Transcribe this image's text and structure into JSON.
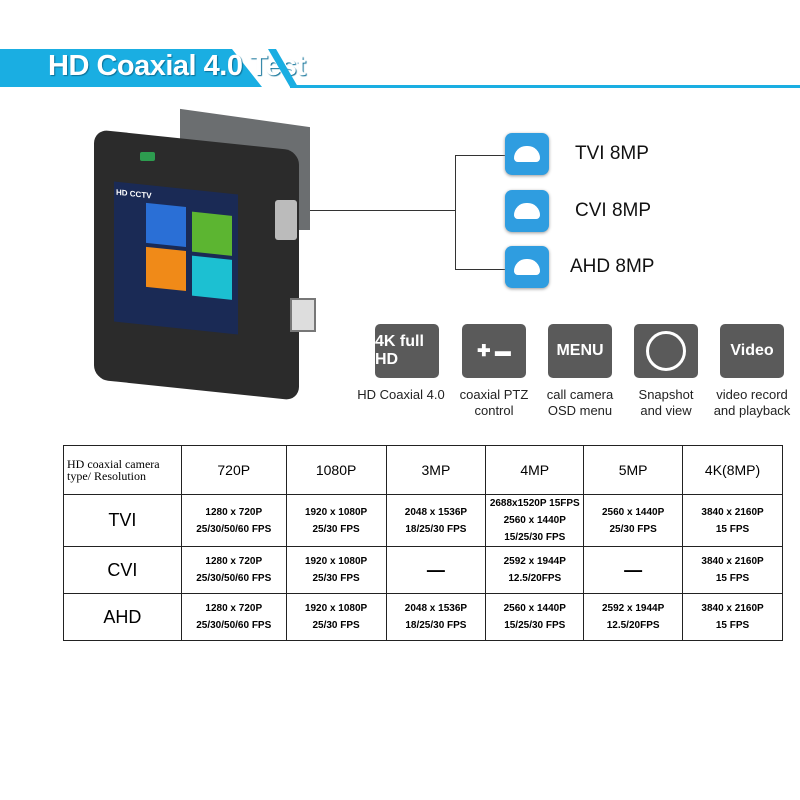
{
  "title": "HD Coaxial 4.0 Test",
  "device": {
    "screen_title": "HD CCTV"
  },
  "camera_types": [
    {
      "label": "TVI 8MP",
      "icon": "bullet-camera-icon"
    },
    {
      "label": "CVI 8MP",
      "icon": "dome-camera-icon"
    },
    {
      "label": "AHD 8MP",
      "icon": "dome-camera-icon"
    }
  ],
  "features": [
    {
      "icon_text": "4K full HD",
      "label1": "HD Coaxial 4.0",
      "label2": ""
    },
    {
      "icon_text": "",
      "label1": "coaxial PTZ",
      "label2": "control"
    },
    {
      "icon_text": "MENU",
      "label1": "call camera",
      "label2": "OSD menu"
    },
    {
      "icon_text": "",
      "label1": "Snapshot",
      "label2": "and view"
    },
    {
      "icon_text": "Video",
      "label1": "video record",
      "label2": "and playback"
    }
  ],
  "table": {
    "corner": "HD coaxial camera type/ Resolution",
    "headers": [
      "720P",
      "1080P",
      "3MP",
      "4MP",
      "5MP",
      "4K(8MP)"
    ],
    "rows": [
      {
        "type": "TVI",
        "cells": [
          [
            "1280 x 720P",
            "25/30/50/60 FPS"
          ],
          [
            "1920 x 1080P",
            "25/30 FPS"
          ],
          [
            "2048 x 1536P",
            "18/25/30 FPS"
          ],
          [
            "2688x1520P 15FPS",
            "2560 x 1440P 15/25/30 FPS"
          ],
          [
            "2560 x 1440P",
            "25/30 FPS"
          ],
          [
            "3840 x 2160P",
            "15 FPS"
          ]
        ]
      },
      {
        "type": "CVI",
        "cells": [
          [
            "1280 x 720P",
            "25/30/50/60 FPS"
          ],
          [
            "1920 x 1080P",
            "25/30 FPS"
          ],
          [
            "—",
            ""
          ],
          [
            "2592 x 1944P",
            "12.5/20FPS"
          ],
          [
            "—",
            ""
          ],
          [
            "3840 x 2160P",
            "15 FPS"
          ]
        ]
      },
      {
        "type": "AHD",
        "cells": [
          [
            "1280 x 720P",
            "25/30/50/60 FPS"
          ],
          [
            "1920 x 1080P",
            "25/30 FPS"
          ],
          [
            "2048 x 1536P",
            "18/25/30 FPS"
          ],
          [
            "2560 x 1440P",
            "15/25/30 FPS"
          ],
          [
            "2592 x 1944P",
            "12.5/20FPS"
          ],
          [
            "3840 x 2160P",
            "15 FPS"
          ]
        ]
      }
    ]
  },
  "colors": {
    "accent": "#1aaee2",
    "icon_gray": "#5a5a5a",
    "camera_blue": "#2f9de0"
  }
}
